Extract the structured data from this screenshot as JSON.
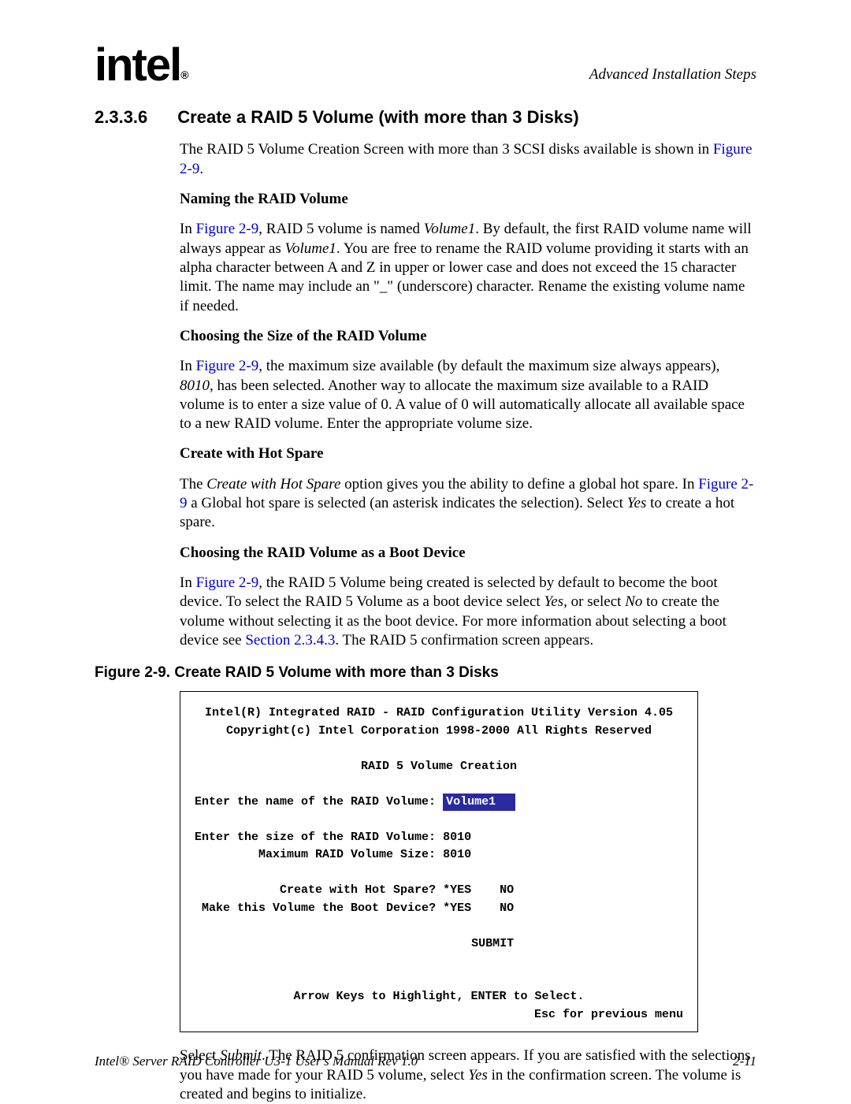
{
  "header": {
    "logo_text": "intel",
    "logo_reg": "®",
    "right_text": "Advanced Installation Steps"
  },
  "section": {
    "number": "2.3.3.6",
    "title": "Create a RAID 5 Volume (with more than 3 Disks)"
  },
  "intro": {
    "pre": "The RAID 5 Volume Creation Screen with more than 3 SCSI disks available is shown in ",
    "link": "Figure 2-9",
    "post": "."
  },
  "naming": {
    "heading": "Naming the RAID Volume",
    "p1_pre": "In ",
    "p1_link": "Figure 2-9",
    "p1_mid": ", RAID 5 volume is named ",
    "p1_em": "Volume1",
    "p1_post1": ". By default, the first RAID volume name will always appear as ",
    "p1_em2": "Volume1",
    "p1_post2": ". You are free to rename the RAID volume providing it starts with an alpha character between A and Z in upper or lower case and does not exceed the 15 character limit. The name may include an \"_\" (underscore) character. Rename the existing volume name if needed."
  },
  "size": {
    "heading": "Choosing the Size of the RAID Volume",
    "p_pre": "In ",
    "p_link": "Figure 2-9",
    "p_mid": ", the maximum size available (by default the maximum size always appears), ",
    "p_em": "8010,",
    "p_post": " has been selected. Another way to allocate the maximum size available to a RAID volume is to enter a size value of 0. A value of 0 will automatically allocate all available space to a new RAID volume. Enter the appropriate volume size."
  },
  "hotspare": {
    "heading": "Create with Hot Spare",
    "p_pre": "The ",
    "p_em": "Create with Hot Spare",
    "p_mid": " option gives you the ability to define a global hot spare. In ",
    "p_link": "Figure 2-9",
    "p_mid2": " a Global hot spare is selected (an asterisk indicates the selection). Select ",
    "p_em2": "Yes",
    "p_post": " to create a hot spare."
  },
  "boot": {
    "heading": "Choosing the RAID Volume as a Boot Device",
    "p_pre": "In ",
    "p_link": "Figure 2-9",
    "p_mid1": ", the RAID 5 Volume being created is selected by default to become the boot device. To select the RAID 5 Volume as a boot device select ",
    "p_em1": "Yes",
    "p_mid2": ", or select ",
    "p_em2": "No",
    "p_mid3": " to create the volume without selecting it as the boot device. For more information about selecting a boot device see ",
    "p_link2": "Section 2.3.4.3",
    "p_post": ". The RAID 5 confirmation screen appears."
  },
  "figure": {
    "caption": "Figure 2-9. Create RAID 5 Volume with more than 3 Disks"
  },
  "bios": {
    "line1": "Intel(R) Integrated RAID - RAID Configuration Utility Version 4.05",
    "line2": "Copyright(c) Intel Corporation 1998-2000 All Rights Reserved",
    "title": "RAID 5 Volume Creation",
    "name_label": "Enter the name of the RAID Volume: ",
    "name_value": "Volume1",
    "size_label": "Enter the size of the RAID Volume: ",
    "size_value": "8010",
    "max_label": "Maximum RAID Volume Size: ",
    "max_value": "8010",
    "hot_label": "Create with Hot Spare? ",
    "hot_yes": "*YES",
    "hot_no": "NO",
    "boot_label": "Make this Volume the Boot Device? ",
    "boot_yes": "*YES",
    "boot_no": "NO",
    "submit": "SUBMIT",
    "hint1": "Arrow Keys to Highlight, ENTER to Select.",
    "hint2": "Esc for previous menu"
  },
  "closing": {
    "pre": "Select ",
    "em1": "Submit",
    "mid1": ". The RAID 5 confirmation screen appears. If you are satisfied with the selections you have made for your RAID 5 volume, select ",
    "em2": "Yes",
    "post": " in the confirmation screen. The volume is created and begins to initialize."
  },
  "footer": {
    "left": "Intel® Server RAID Controller U3-1 User's Manual Rev 1.0",
    "right": "2-11"
  }
}
